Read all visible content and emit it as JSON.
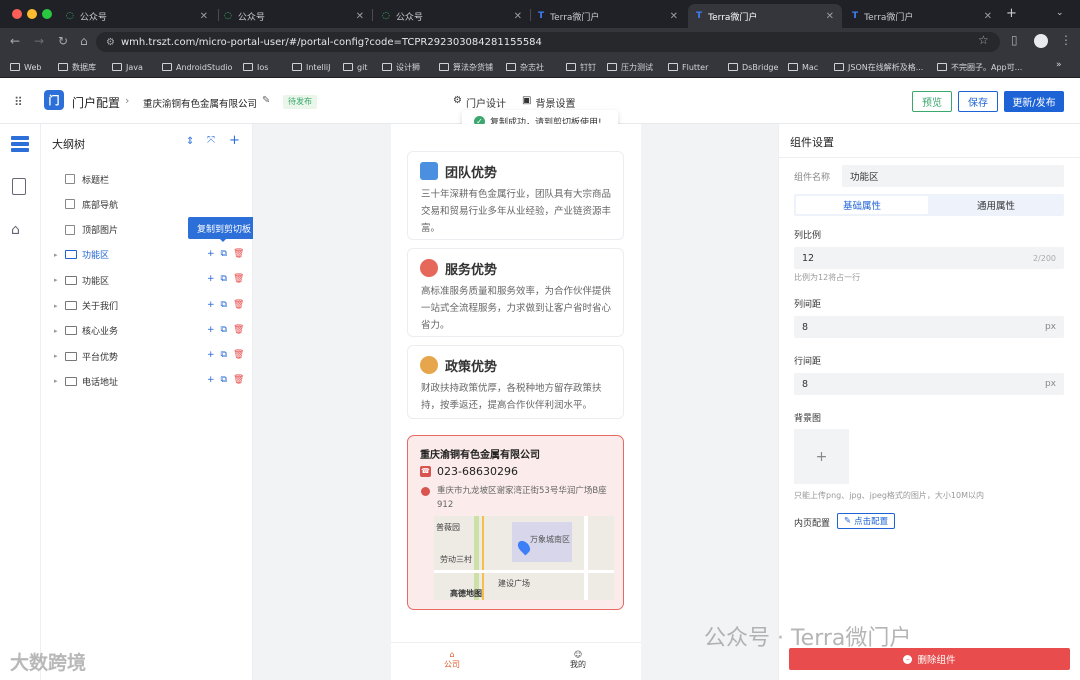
{
  "browser": {
    "tabs": [
      {
        "title": "公众号"
      },
      {
        "title": "公众号"
      },
      {
        "title": "公众号"
      },
      {
        "title": "Terra微门户"
      },
      {
        "title": "Terra微门户"
      },
      {
        "title": "Terra微门户"
      }
    ],
    "url": "wmh.trszt.com/micro-portal-user/#/portal-config?code=TCPR292303084281155584",
    "bookmarks": [
      "Web",
      "数据库",
      "Java",
      "AndroidStudio",
      "Ios",
      "IntelliJ",
      "git",
      "设计狮",
      "算法杂货铺",
      "杂志社",
      "钉钉",
      "压力测试",
      "Flutter",
      "DsBridge",
      "Mac",
      "JSON在线解析及格...",
      "不完圈子。App可..."
    ]
  },
  "header": {
    "app_title": "门户配置",
    "company": "重庆渝铜有色金属有限公司",
    "status": "待发布",
    "portal_design": "门户设计",
    "bg_settings": "背景设置",
    "preview": "预览",
    "save": "保存",
    "publish": "更新/发布"
  },
  "toast": {
    "text": "复制成功，请到剪切板使用!"
  },
  "tree": {
    "title": "大纲树",
    "tooltip": "复制到剪切板",
    "items": [
      {
        "label": "标题栏"
      },
      {
        "label": "底部导航"
      },
      {
        "label": "顶部图片"
      },
      {
        "label": "功能区"
      },
      {
        "label": "功能区"
      },
      {
        "label": "关于我们"
      },
      {
        "label": "核心业务"
      },
      {
        "label": "平台优势"
      },
      {
        "label": "电话地址"
      }
    ]
  },
  "phone": {
    "cards": [
      {
        "title": "团队优势",
        "text": "三十年深耕有色金属行业，团队具有大宗商品交易和贸易行业多年从业经验，产业链资源丰富。"
      },
      {
        "title": "服务优势",
        "text": "高标准服务质量和服务效率，为合作伙伴提供一站式全流程服务，力求做到让客户省时省心省力。"
      },
      {
        "title": "政策优势",
        "text": "财政扶持政策优厚，各税种地方留存政策扶持，按季返还，提高合作伙伴利润水平。"
      }
    ],
    "contact": {
      "company": "重庆渝铜有色金属有限公司",
      "phone": "023-68630296",
      "address": "重庆市九龙坡区谢家湾正街53号华润广场B座912"
    },
    "map_labels": {
      "a": "普薇园",
      "b": "万象城南区",
      "c": "劳动三村",
      "d": "建设广场",
      "e": "高德地图"
    },
    "bottom_nav": {
      "company": "公司",
      "mine": "我的"
    }
  },
  "panel": {
    "title": "组件设置",
    "name_label": "组件名称",
    "name_value": "功能区",
    "tab_basic": "基础属性",
    "tab_common": "通用属性",
    "col_ratio_label": "列比例",
    "col_ratio_value": "12",
    "col_ratio_count": "2/200",
    "col_ratio_hint": "比例为12将占一行",
    "col_gap_label": "列间距",
    "col_gap_value": "8",
    "row_gap_label": "行间距",
    "row_gap_value": "8",
    "unit": "px",
    "bg_label": "背景图",
    "bg_hint": "只能上传png、jpg、jpeg格式的图片，大小10M以内",
    "inner_label": "内页配置",
    "inner_button": "点击配置",
    "delete": "删除组件"
  },
  "watermark": {
    "left": "大数跨境",
    "right": "公众号 · Terra微门户"
  },
  "colors": {
    "primary": "#1e63d6",
    "danger": "#e84c4c",
    "success": "#3aa76d"
  }
}
